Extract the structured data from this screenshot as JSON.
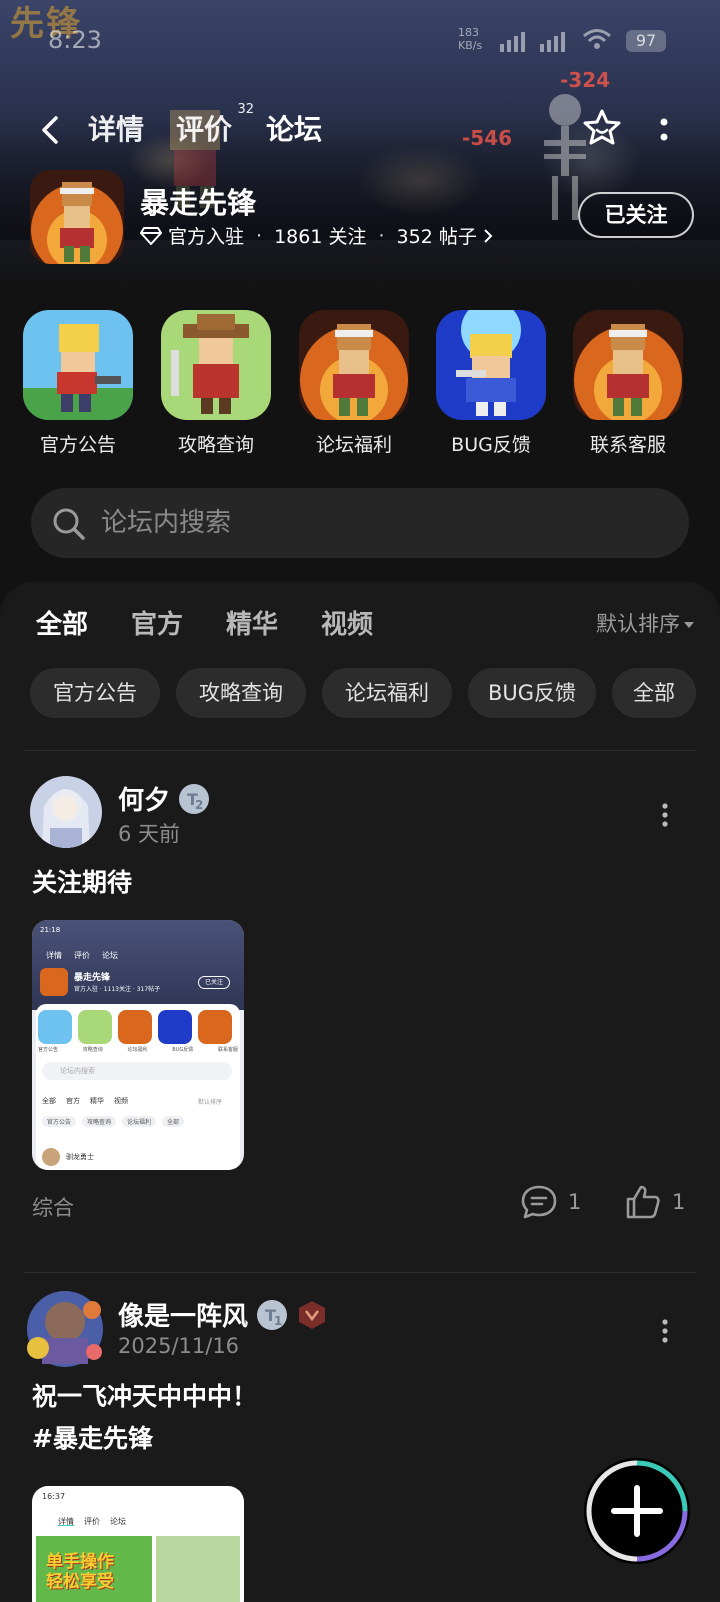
{
  "status_bar": {
    "time": "8:23",
    "speed_top": "183",
    "speed_bottom": "KB/s",
    "battery": "97"
  },
  "banner": {
    "logo_text": "先锋",
    "damage": [
      "-324",
      "-546"
    ]
  },
  "nav": {
    "tabs": [
      {
        "label": "详情"
      },
      {
        "label": "评价",
        "badge": "32"
      },
      {
        "label": "论坛"
      }
    ]
  },
  "game": {
    "title": "暴走先锋",
    "verified": "官方入驻",
    "followers": "1861 关注",
    "posts": "352 帖子",
    "follow_label": "已关注"
  },
  "entries": [
    {
      "label": "官方公告"
    },
    {
      "label": "攻略查询"
    },
    {
      "label": "论坛福利"
    },
    {
      "label": "BUG反馈"
    },
    {
      "label": "联系客服"
    }
  ],
  "search": {
    "placeholder": "论坛内搜索"
  },
  "filter_tabs": [
    "全部",
    "官方",
    "精华",
    "视频"
  ],
  "sort_label": "默认排序",
  "chips": [
    "官方公告",
    "攻略查询",
    "论坛福利",
    "BUG反馈",
    "全部"
  ],
  "posts": [
    {
      "user": "何夕",
      "level": "2",
      "time": "6 天前",
      "text": "关注期待",
      "category": "综合",
      "comments": "1",
      "likes": "1",
      "thumb": {
        "time": "21:18",
        "tabs": [
          "详情",
          "评价",
          "论坛"
        ],
        "title": "暴走先锋",
        "meta": "官方入驻 · 1113关注 · 317帖子",
        "follow": "已关注",
        "entries": [
          "官方公告",
          "攻略查询",
          "论坛福利",
          "BUG反馈",
          "联系客服"
        ],
        "search": "论坛内搜索",
        "ftabs": [
          "全部",
          "官方",
          "精华",
          "视频"
        ],
        "sort": "默认排序",
        "chips": [
          "官方公告",
          "攻略查询",
          "论坛福利",
          "全部"
        ],
        "user": "驯龙勇士"
      }
    },
    {
      "user": "像是一阵风",
      "level": "1",
      "time": "2025/11/16",
      "text": "祝一飞冲天中中中！\n#暴走先锋",
      "thumb": {
        "time": "16:37",
        "tabs": [
          "详情",
          "评价",
          "论坛"
        ],
        "banner_text": "单手操作\n轻松享受"
      }
    }
  ],
  "colors": {
    "accent": "#3bc9b8",
    "background": "#121212",
    "panel": "#1a1a1a",
    "chip": "#2c2c2c"
  }
}
